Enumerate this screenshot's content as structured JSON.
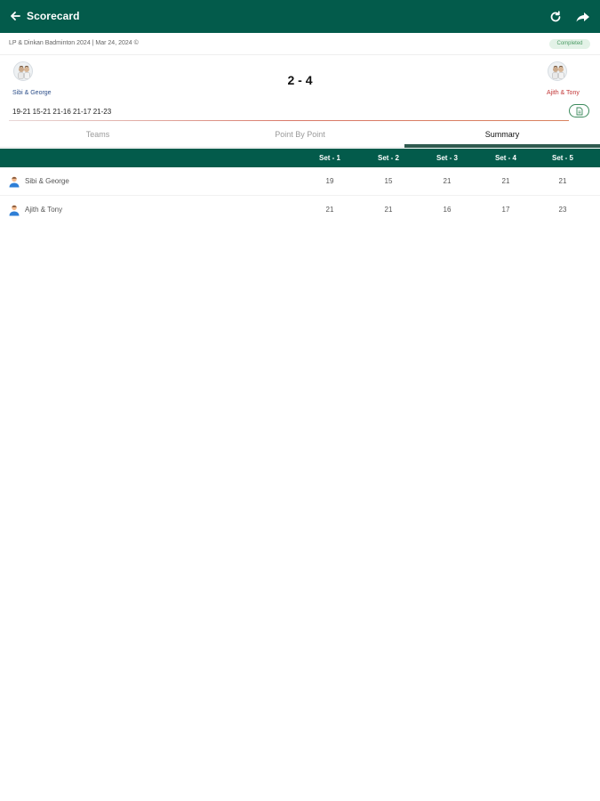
{
  "appbar": {
    "title": "Scorecard"
  },
  "meta": {
    "info": "LP & Dinkan Badminton 2024 | Mar 24, 2024 ©",
    "status": "Completed"
  },
  "match": {
    "team_a": "Sibi & George",
    "team_b": "Ajith & Tony",
    "score": "2 - 4",
    "set_scores": "19-21 15-21 21-16 21-17 21-23"
  },
  "tabs": [
    {
      "label": "Teams"
    },
    {
      "label": "Point By Point"
    },
    {
      "label": "Summary"
    }
  ],
  "active_tab": "Summary",
  "summary": {
    "columns": [
      "Set - 1",
      "Set - 2",
      "Set - 3",
      "Set - 4",
      "Set - 5"
    ],
    "rows": [
      {
        "team": "Sibi & George",
        "scores": [
          "19",
          "15",
          "21",
          "21",
          "21"
        ]
      },
      {
        "team": "Ajith & Tony",
        "scores": [
          "21",
          "21",
          "16",
          "17",
          "23"
        ]
      }
    ]
  },
  "colors": {
    "primary": "#035b4b",
    "team_a": "#2d4f8a",
    "team_b": "#c23636",
    "badge_bg": "#e3f2e7",
    "badge_text": "#4a9a63"
  },
  "icons": {
    "back": "arrow-left-icon",
    "refresh": "refresh-icon",
    "share": "share-icon",
    "document": "document-icon",
    "user": "user-icon",
    "avatar": "players-avatar-icon"
  }
}
